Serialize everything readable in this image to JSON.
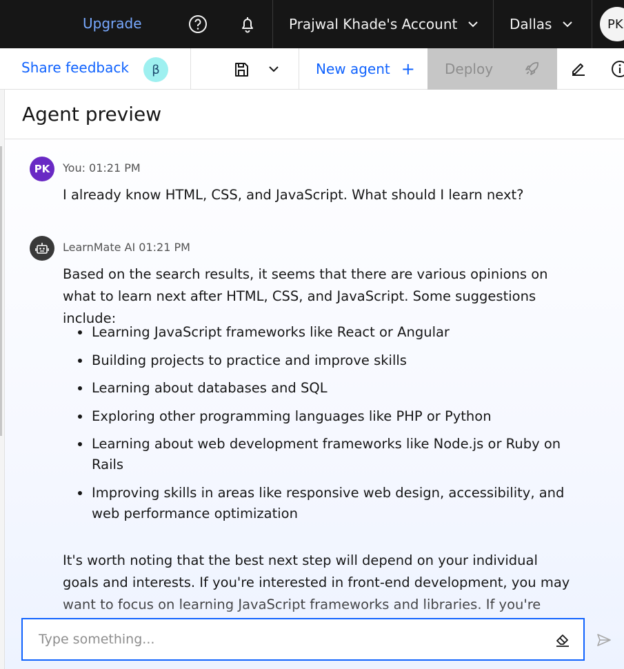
{
  "topbar": {
    "upgrade": "Upgrade",
    "account": "Prajwal Khade's Account",
    "region": "Dallas",
    "avatar": "PK",
    "icons": [
      "help-icon",
      "notification-icon",
      "chevron-down-icon"
    ]
  },
  "toolbar": {
    "feedback": "Share feedback",
    "beta": "β",
    "new_agent": "New agent",
    "new_agent_icon": "+",
    "deploy": "Deploy",
    "icons": [
      "save-icon",
      "chevron-down-icon",
      "add-icon",
      "rocket-icon",
      "edit-icon",
      "info-icon"
    ]
  },
  "preview": {
    "title": "Agent preview",
    "messages": [
      {
        "avatar": "PK",
        "meta": "You: 01:21 PM",
        "text": "I already know HTML, CSS, and JavaScript. What should I learn next?"
      },
      {
        "avatar_icon": "bot-icon",
        "meta": "LearnMate AI 01:21 PM",
        "intro": "Based on the search results, it seems that there are various opinions on what to learn next after HTML, CSS, and JavaScript. Some suggestions include:",
        "bullets": [
          "Learning JavaScript frameworks like React or Angular",
          "Building projects to practice and improve skills",
          "Learning about databases and SQL",
          "Exploring other programming languages like PHP or Python",
          "Learning about web development frameworks like Node.js or Ruby on Rails",
          "Improving skills in areas like responsive web design, accessibility, and web performance optimization"
        ],
        "tail": "It's worth noting that the best next step will depend on your individual goals and interests. If you're interested in front-end development, you may want to focus on learning JavaScript frameworks and libraries. If you're interested in"
      }
    ]
  },
  "input": {
    "placeholder": "Type something...",
    "icons": [
      "erase-icon",
      "send-icon"
    ]
  },
  "colors": {
    "accent": "#0f62fe",
    "topbar": "#161616",
    "user_avatar": "#6929c4",
    "beta_badge": "#9ef0f0",
    "deploy_disabled": "#c6c6c6"
  }
}
